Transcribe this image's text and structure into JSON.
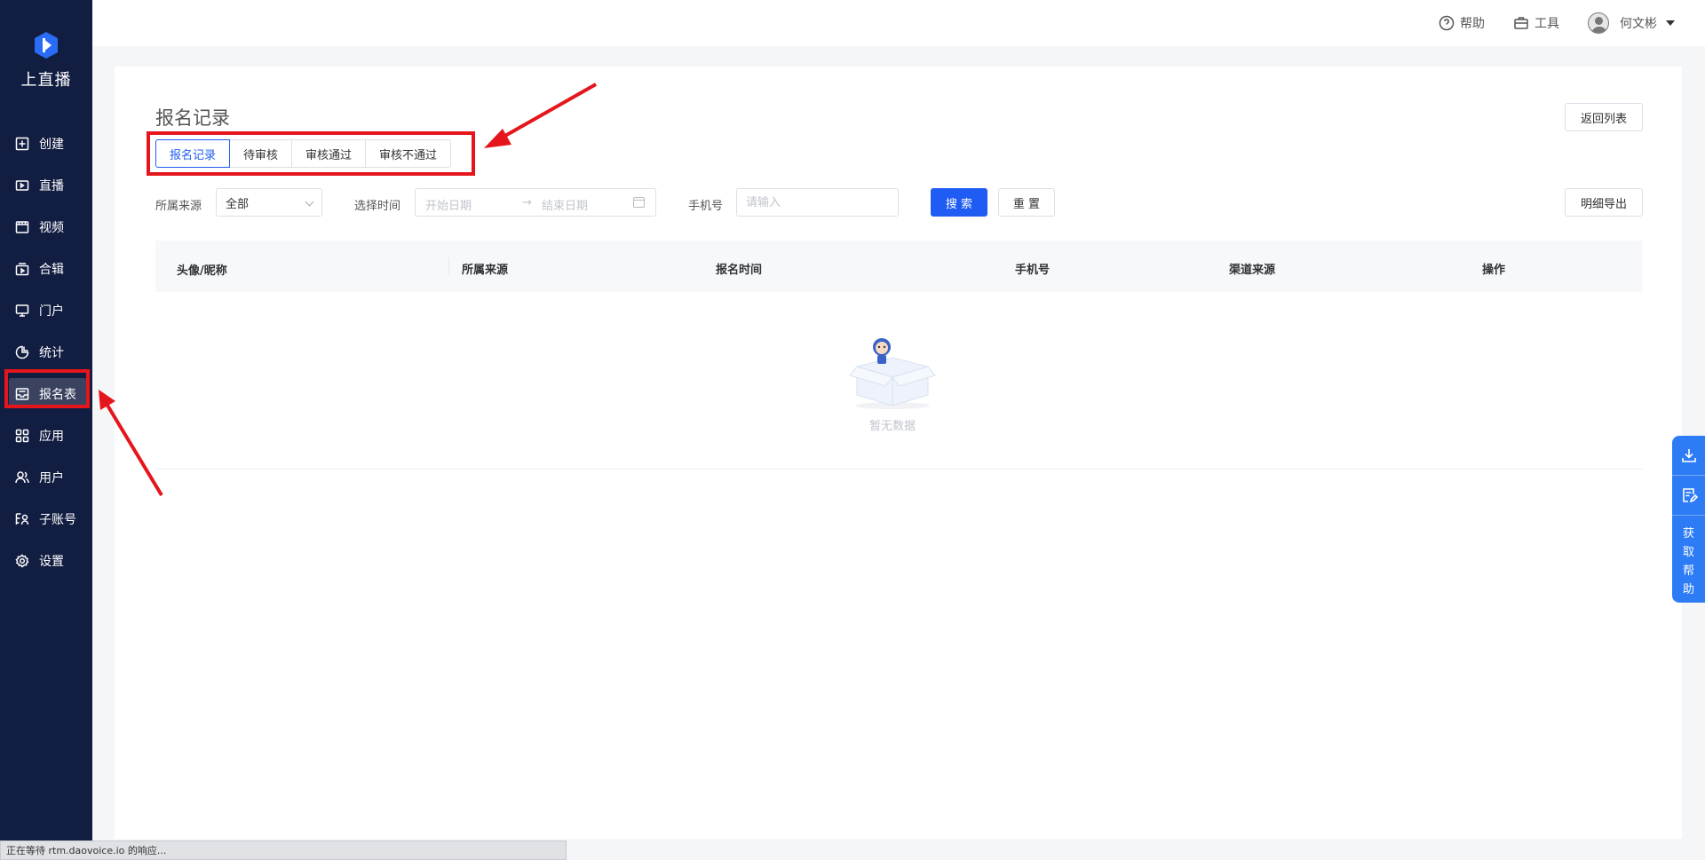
{
  "app": {
    "logo_text": "上直播"
  },
  "sidebar": {
    "items": [
      {
        "label": "创建",
        "icon": "plus-square-icon"
      },
      {
        "label": "直播",
        "icon": "video-camera-icon"
      },
      {
        "label": "视频",
        "icon": "film-icon"
      },
      {
        "label": "合辑",
        "icon": "collection-icon"
      },
      {
        "label": "门户",
        "icon": "monitor-icon"
      },
      {
        "label": "统计",
        "icon": "pie-chart-icon"
      },
      {
        "label": "报名表",
        "icon": "form-tray-icon",
        "active": true
      },
      {
        "label": "应用",
        "icon": "apps-grid-icon"
      },
      {
        "label": "用户",
        "icon": "users-icon"
      },
      {
        "label": "子账号",
        "icon": "sub-account-icon"
      },
      {
        "label": "设置",
        "icon": "gear-icon"
      }
    ]
  },
  "header": {
    "help_label": "帮助",
    "tools_label": "工具",
    "user_name": "何文彬"
  },
  "page": {
    "title": "报名记录",
    "back_label": "返回列表",
    "export_label": "明细导出"
  },
  "tabs": [
    {
      "label": "报名记录",
      "active": true
    },
    {
      "label": "待审核"
    },
    {
      "label": "审核通过"
    },
    {
      "label": "审核不通过"
    }
  ],
  "filters": {
    "source_label": "所属来源",
    "source_value": "全部",
    "time_label": "选择时间",
    "start_placeholder": "开始日期",
    "range_separator": "→",
    "end_placeholder": "结束日期",
    "phone_label": "手机号",
    "phone_placeholder": "请输入",
    "search_label": "搜 索",
    "reset_label": "重 置"
  },
  "table": {
    "columns": [
      "头像/昵称",
      "所属来源",
      "报名时间",
      "手机号",
      "渠道来源",
      "操作"
    ],
    "empty_text": "暂无数据"
  },
  "float_help": {
    "text_chars": [
      "获",
      "取",
      "帮",
      "助"
    ]
  },
  "statusbar": {
    "text": "正在等待 rtm.daovoice.io 的响应..."
  },
  "colors": {
    "sidebar_bg": "#121d42",
    "primary": "#1f5cf3",
    "annotation_red": "#e5151c",
    "float_blue": "#2d7cf6"
  }
}
